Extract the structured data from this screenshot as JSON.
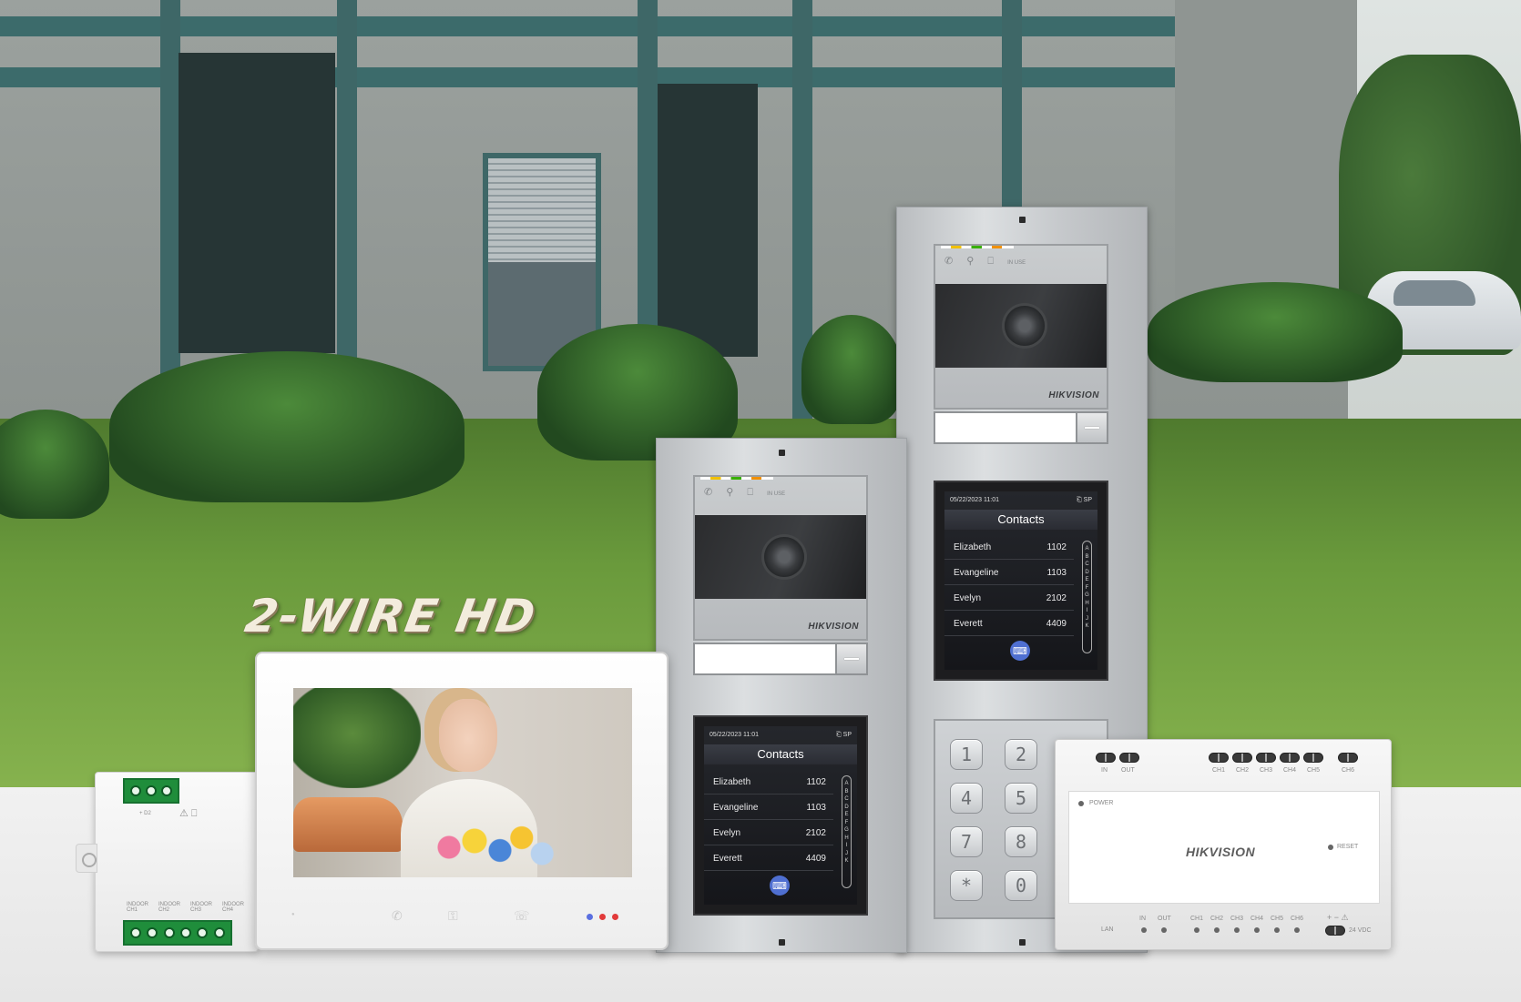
{
  "headline": "2-WIRE HD",
  "brand": "HIKVISION",
  "door_station": {
    "status_icons": "✆ ⚲ ⎕",
    "in_use": "IN USE",
    "contacts_screen": {
      "date_time": "05/22/2023 11:01",
      "status_right": "⎗ SP",
      "title": "Contacts",
      "contacts": [
        {
          "name": "Elizabeth",
          "number": "1102"
        },
        {
          "name": "Evangeline",
          "number": "1103"
        },
        {
          "name": "Evelyn",
          "number": "2102"
        },
        {
          "name": "Everett",
          "number": "4409"
        }
      ],
      "alphabet": [
        "A",
        "B",
        "C",
        "D",
        "E",
        "F",
        "G",
        "H",
        "I",
        "J",
        "K"
      ]
    },
    "keypad_keys": [
      "1",
      "2",
      "4",
      "5",
      "7",
      "8",
      "*",
      "0"
    ]
  },
  "distributor_right": {
    "power_label": "POWER",
    "reset_label": "RESET",
    "top_labels": [
      "IN",
      "OUT",
      "CH1",
      "CH2",
      "CH3",
      "CH4",
      "CH5",
      "CH6"
    ],
    "bottom_labels": [
      "LAN",
      "IN",
      "OUT",
      "CH1",
      "CH2",
      "CH3",
      "CH4",
      "CH5",
      "CH6"
    ],
    "voltage": "24 VDC"
  },
  "distributor_left": {
    "top_labels": "+  D2",
    "bottom_labels": [
      "INDOOR CH1",
      "INDOOR CH2",
      "INDOOR CH3",
      "INDOOR CH4"
    ]
  },
  "colors": {
    "lcd_accent": "#4f6fd1",
    "terminal_green": "#1f8d3b",
    "led_red": "#e23a3a",
    "led_blue": "#5a6fe0"
  }
}
